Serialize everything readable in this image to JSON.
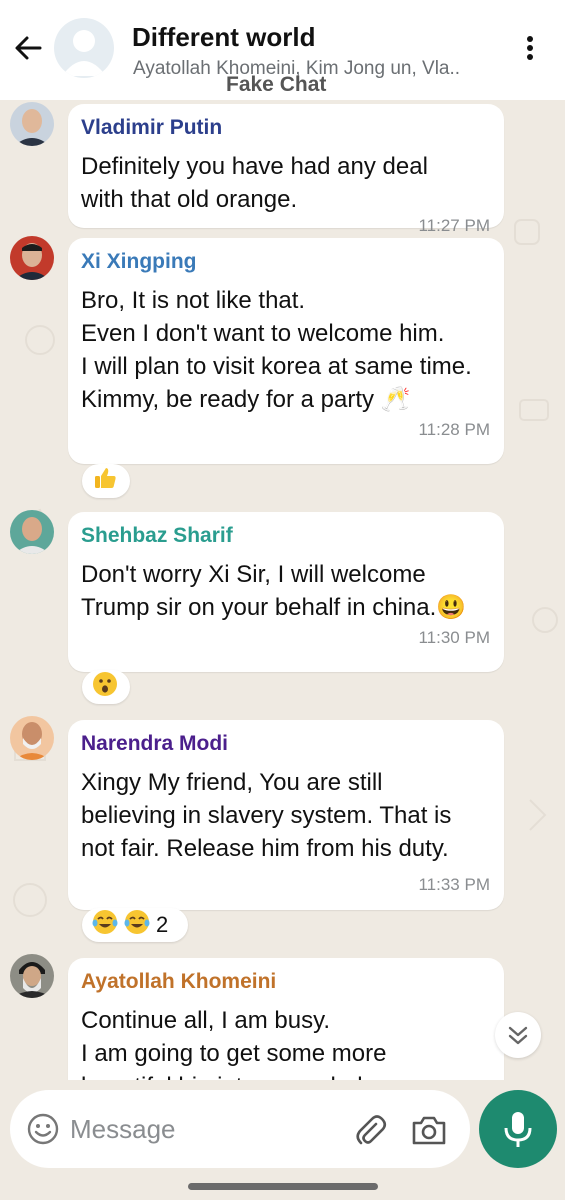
{
  "header": {
    "title": "Different world",
    "subtitle": "Ayatollah Khomeini, Kim Jong un, Vla..",
    "watermark": "Fake Chat"
  },
  "messages": [
    {
      "sender": "Vladimir Putin",
      "sender_color": "#2c3f8c",
      "text": "Definitely you have had any deal\nwith that old orange.",
      "time": "11:27 PM"
    },
    {
      "sender": "Xi Xingping",
      "sender_color": "#3a7ab8",
      "text": "Bro, It is not like that.\nEven I don't want to welcome him.\nI will plan to visit korea at same time.\nKimmy, be ready for a party 🥂",
      "time": "11:28 PM",
      "reaction": "thumbs-up"
    },
    {
      "sender": "Shehbaz Sharif",
      "sender_color": "#2a9d8f",
      "text": "Don't worry Xi Sir, I will welcome\nTrump sir on your behalf in china.😃",
      "time": "11:30 PM",
      "reaction": "surprised-face"
    },
    {
      "sender": "Narendra Modi",
      "sender_color": "#4b1f8c",
      "text": "Xingy My friend, You are still\nbelieving in slavery system. That is\nnot fair. Release him from his duty.",
      "time": "11:33 PM",
      "reactions": [
        "tears-of-joy",
        "tears-of-joy"
      ],
      "reaction_count": "2"
    },
    {
      "sender": "Ayatollah Khomeini",
      "sender_color": "#c0722a",
      "text": "Continue all, I am busy.\nI am going to get some more\nbeautiful big jets grounded"
    }
  ],
  "composer": {
    "placeholder": "Message"
  },
  "colors": {
    "accent": "#1e8a6f",
    "chat_bg": "#efeae2"
  }
}
